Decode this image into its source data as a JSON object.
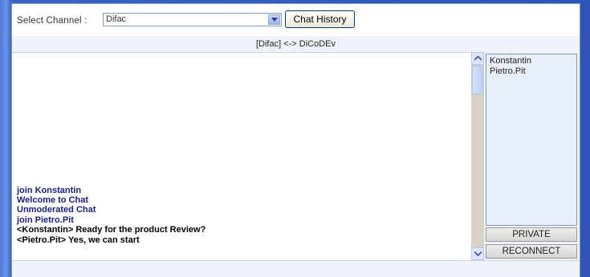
{
  "header": {
    "select_label": "Select Channel :",
    "channel_value": "Difac",
    "history_button": "Chat History"
  },
  "channel_title": "[Difac] <-> DiCoDEv",
  "messages": [
    {
      "text": "join Konstantin",
      "kind": "system"
    },
    {
      "text": "Welcome to Chat",
      "kind": "system"
    },
    {
      "text": "Unmoderated Chat",
      "kind": "system"
    },
    {
      "text": "join Pietro.Pit",
      "kind": "system"
    },
    {
      "text": "<Konstantin> Ready for the product Review?",
      "kind": "user"
    },
    {
      "text": "<Pietro.Pit> Yes, we can start",
      "kind": "user"
    }
  ],
  "users": [
    "Konstantin",
    "Pietro.Pit"
  ],
  "buttons": {
    "private": "PRIVATE",
    "reconnect": "RECONNECT"
  },
  "colors": {
    "system_message": "#1a2080",
    "user_message": "#000000",
    "background": "#2d56b8"
  }
}
